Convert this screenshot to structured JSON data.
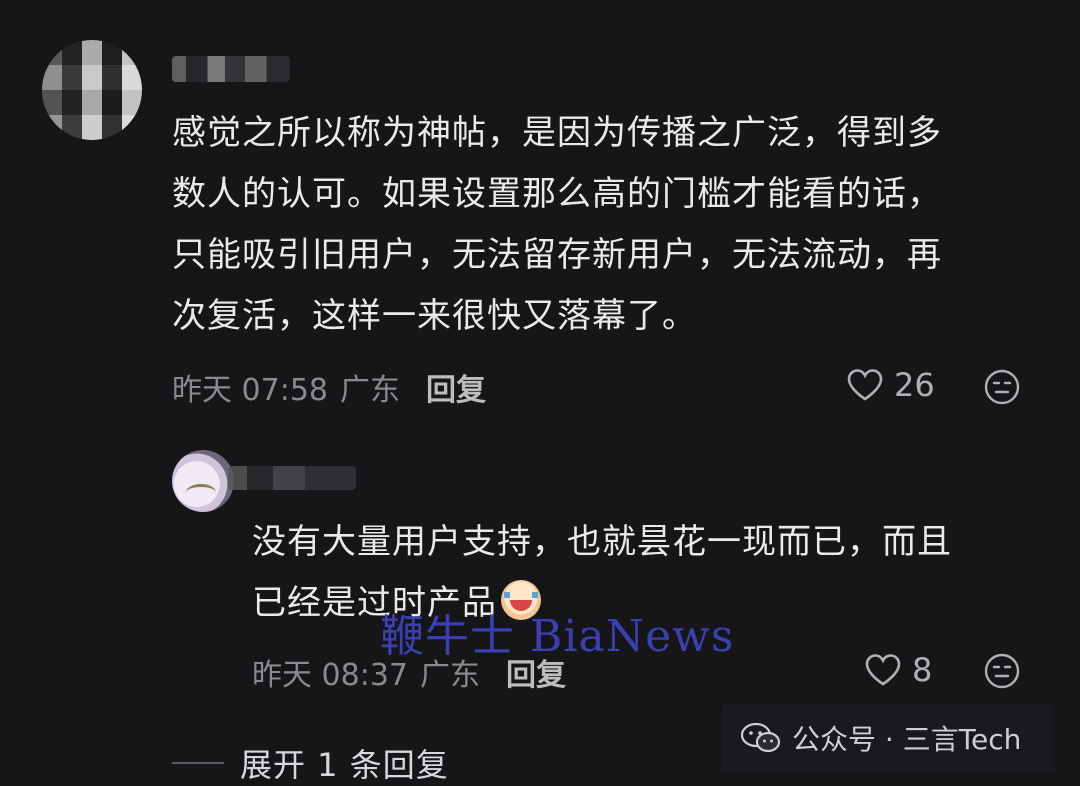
{
  "comments": [
    {
      "text": "感觉之所以称为神帖，是因为传播之广泛，得到多\n数人的认可。如果设置那么高的门槛才能看的话，\n只能吸引旧用户，无法留存新用户，无法流动，再\n次复活，这样一来很快又落幕了。",
      "time": "昨天 07:58",
      "location": "广东",
      "reply_label": "回复",
      "likes": "26"
    },
    {
      "text": "没有大量用户支持，也就昙花一现而已，而且\n已经是过时产品",
      "time": "昨天 08:37",
      "location": "广东",
      "reply_label": "回复",
      "likes": "8"
    }
  ],
  "expand_label": "展开 1 条回复",
  "watermark": "鞭牛士 BiaNews",
  "account_badge": "公众号 · 三言Tech",
  "icons": [
    "heart-outline-icon",
    "comment-face-icon",
    "crying-emoji-icon",
    "wechat-icon"
  ]
}
